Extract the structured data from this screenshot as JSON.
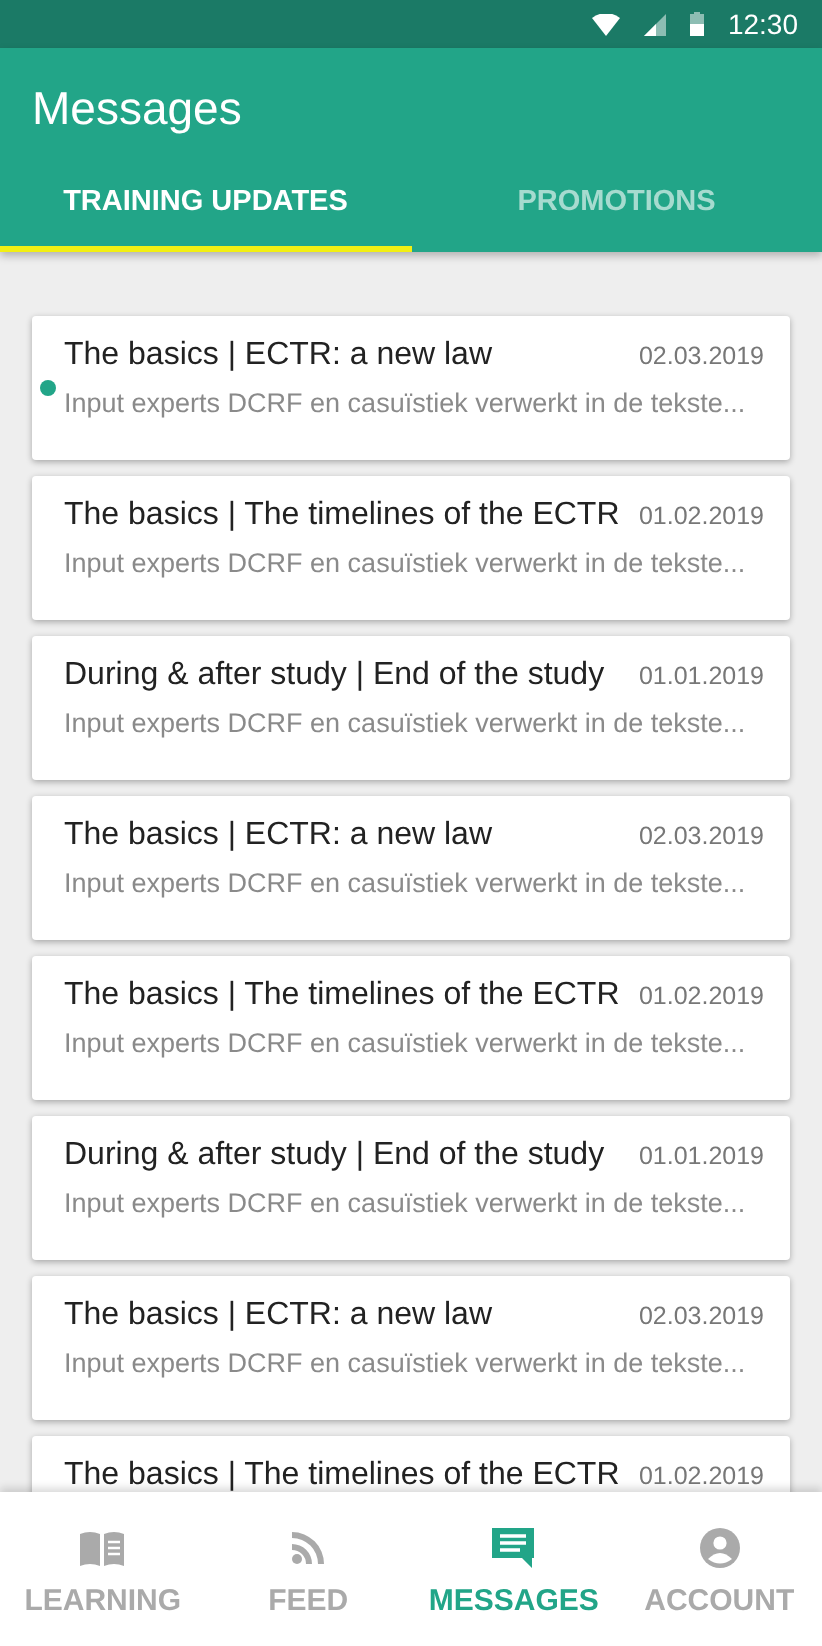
{
  "status_bar": {
    "time": "12:30"
  },
  "app_bar": {
    "title": "Messages"
  },
  "tabs": [
    {
      "label": "TRAINING UPDATES",
      "selected": true
    },
    {
      "label": "PROMOTIONS",
      "selected": false
    }
  ],
  "messages": [
    {
      "title": "The basics | ECTR: a new law",
      "date": "02.03.2019",
      "preview": "Input experts DCRF en casuïstiek verwerkt in de tekste...",
      "unread": true
    },
    {
      "title": "The basics | The timelines of the ECTR",
      "date": "01.02.2019",
      "preview": "Input experts DCRF en casuïstiek verwerkt in de tekste...",
      "unread": false
    },
    {
      "title": "During & after study | End of the study",
      "date": "01.01.2019",
      "preview": "Input experts DCRF en casuïstiek verwerkt in de tekste...",
      "unread": false
    },
    {
      "title": "The basics | ECTR: a new law",
      "date": "02.03.2019",
      "preview": "Input experts DCRF en casuïstiek verwerkt in de tekste...",
      "unread": false
    },
    {
      "title": "The basics | The timelines of the ECTR",
      "date": "01.02.2019",
      "preview": "Input experts DCRF en casuïstiek verwerkt in de tekste...",
      "unread": false
    },
    {
      "title": "During & after study | End of the study",
      "date": "01.01.2019",
      "preview": "Input experts DCRF en casuïstiek verwerkt in de tekste...",
      "unread": false
    },
    {
      "title": "The basics | ECTR: a new law",
      "date": "02.03.2019",
      "preview": "Input experts DCRF en casuïstiek verwerkt in de tekste...",
      "unread": false
    },
    {
      "title": "The basics | The timelines of the ECTR",
      "date": "01.02.2019",
      "unread": false
    }
  ],
  "bottom_nav": [
    {
      "label": "LEARNING",
      "kind": "book",
      "selected": false
    },
    {
      "label": "FEED",
      "kind": "feed",
      "selected": false
    },
    {
      "label": "MESSAGES",
      "kind": "message",
      "selected": true
    },
    {
      "label": "ACCOUNT",
      "kind": "account",
      "selected": false
    }
  ]
}
